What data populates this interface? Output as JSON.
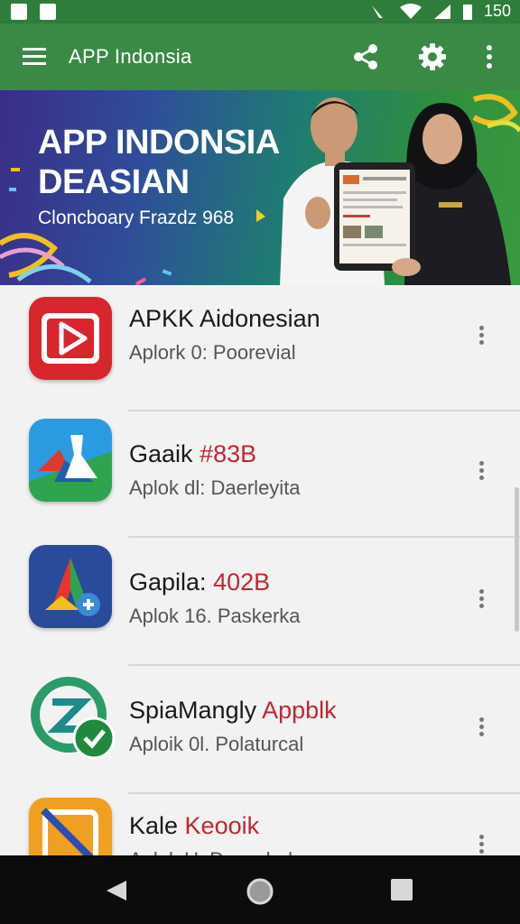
{
  "status_bar": {
    "time": "150"
  },
  "app_bar": {
    "title": "APP Indonsia"
  },
  "banner": {
    "headline_line1": "APP INDONSIA",
    "headline_line2": "DEASIAN",
    "subtitle": "Cloncboary Frazdz 968"
  },
  "apps": [
    {
      "name": "APKK Aidonesian",
      "name_accent": "",
      "meta": "Aplork 0: Poorevial",
      "icon": "video-play-icon",
      "icon_color": "#d8262c"
    },
    {
      "name": "Gaaik ",
      "name_accent": "#83B",
      "meta": "Aplok dl: Daerleyita",
      "icon": "flask-icon",
      "icon_color": "#2a8fd8"
    },
    {
      "name": "Gapila: ",
      "name_accent": "402B",
      "meta": "Aplok 16. Paskerka",
      "icon": "triangle-plus-icon",
      "icon_color": "#2a4b9a"
    },
    {
      "name": "SpiaMangly ",
      "name_accent": "Appblk",
      "meta": "Aploik 0l. Polaturcal",
      "icon": "check-badge-icon",
      "icon_color": "#1f8a58"
    },
    {
      "name": "Kale ",
      "name_accent": "Keooik",
      "meta": "Aplok U. Dreswhol",
      "icon": "slash-square-icon",
      "icon_color": "#f0a020"
    }
  ],
  "colors": {
    "app_bar": "#3a8a46",
    "status_bar": "#2f7d3a",
    "accent_text": "#c0282d",
    "nav_bar": "#0c0c0c"
  }
}
